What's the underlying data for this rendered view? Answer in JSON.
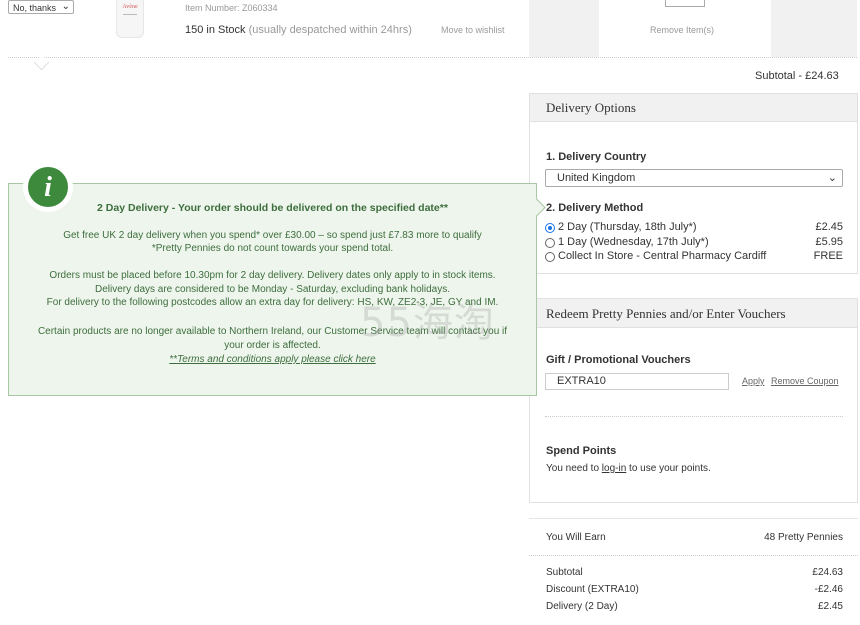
{
  "cart_item": {
    "opt_select_value": "No, thanks",
    "product_brand": "Avène",
    "item_number": "Item Number: Z060334",
    "stock_count": "150 in Stock",
    "stock_note": "(usually despatched within 24hrs)",
    "move_to_wishlist": "Move to wishlist",
    "remove_items": "Remove Item(s)"
  },
  "subtotal_line": "Subtotal -   £24.63",
  "delivery": {
    "header": "Delivery Options",
    "country_label": "1. Delivery Country",
    "country_value": "United Kingdom",
    "method_label": "2. Delivery Method",
    "options": [
      {
        "label": "2 Day (Thursday, 18th July*)",
        "price": "£2.45",
        "selected": true
      },
      {
        "label": "1 Day (Wednesday, 17th July*)",
        "price": "£5.95",
        "selected": false
      },
      {
        "label": "Collect In Store - Central Pharmacy Cardiff",
        "price": "FREE",
        "selected": false
      }
    ]
  },
  "vouchers": {
    "header": "Redeem Pretty Pennies and/or Enter Vouchers",
    "gift_label": "Gift / Promotional Vouchers",
    "voucher_value": "EXTRA10",
    "apply_link": "Apply",
    "remove_coupon_link": "Remove Coupon",
    "spend_points_label": "Spend Points",
    "spend_text_before": "You need to ",
    "login_link": "log-in",
    "spend_text_after": " to use your points."
  },
  "summary": {
    "earn_label": "You Will Earn",
    "earn_value": "48 Pretty Pennies",
    "rows": [
      {
        "label": "Subtotal",
        "value": "£24.63"
      },
      {
        "label": "Discount (EXTRA10)",
        "value": "-£2.46"
      },
      {
        "label": "Delivery (2 Day)",
        "value": "£2.45"
      }
    ]
  },
  "info_popup": {
    "icon_glyph": "i",
    "title": "2 Day Delivery - Your order should be delivered on the specified date**",
    "line1": "Get free UK 2 day delivery when you spend* over £30.00 – so spend just £7.83 more to qualify",
    "line2": "*Pretty Pennies do not count towards your spend total.",
    "line3": "Orders must be placed before 10.30pm for 2 day delivery. Delivery dates only apply to in stock items.",
    "line4": "Delivery days are considered to be Monday - Saturday, excluding bank holidays.",
    "line5": "For delivery to the following postcodes allow an extra day for delivery: HS, KW, ZE2-3, JE, GY and IM.",
    "line6": "Certain products are no longer available to Northern Ireland, our Customer Service team will contact you if",
    "line7": "your order is affected.",
    "terms_link": "**Terms and conditions apply please click here"
  },
  "watermark": "55海淘"
}
